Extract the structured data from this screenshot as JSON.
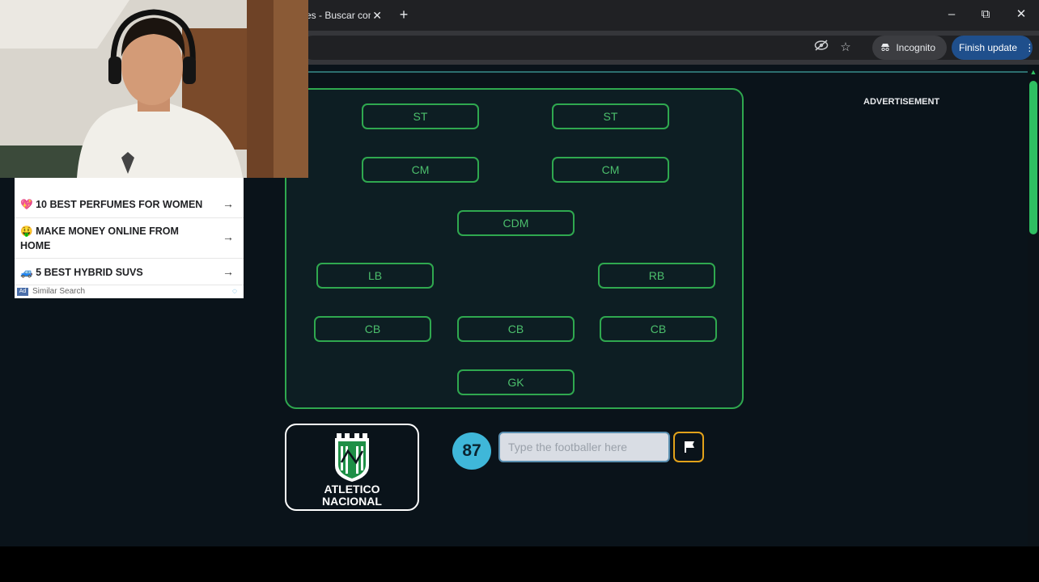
{
  "browser": {
    "tab_title": "es - Buscar con",
    "tab_close": "✕",
    "new_tab": "+",
    "incognito_label": "Incognito",
    "finish_update_label": "Finish update",
    "window_controls": {
      "minimize": "–",
      "restore": "⧉",
      "close": "✕"
    },
    "icons": {
      "eye_off": "eye-off-icon",
      "star": "star-icon",
      "menu": "kebab-menu-icon"
    }
  },
  "page": {
    "advertisement_label": "ADVERTISEMENT",
    "positions": [
      "ST",
      "ST",
      "CM",
      "CM",
      "CDM",
      "LB",
      "RB",
      "CB",
      "CB",
      "CB",
      "GK"
    ],
    "club_name_line1": "ATLETICO",
    "club_name_line2": "NACIONAL",
    "score": "87",
    "guess_placeholder": "Type the footballer here",
    "guess_value": ""
  },
  "ads": {
    "items": [
      {
        "emoji": "💖",
        "label": "10 BEST PERFUMES FOR WOMEN",
        "arrow": "→"
      },
      {
        "emoji": "🤑",
        "label": "MAKE MONEY ONLINE FROM HOME",
        "arrow": "→"
      },
      {
        "emoji": "🚙",
        "label": "5 BEST HYBRID SUVS",
        "arrow": "→"
      }
    ],
    "badge": "Ad",
    "footer": "Similar Search"
  },
  "colors": {
    "pitch_border": "#2fa84f",
    "position_text": "#4cbf6c",
    "score_bg": "#3fb7d9",
    "flag_border": "#e2a21a",
    "finish_update_bg": "#1f4f8c"
  }
}
